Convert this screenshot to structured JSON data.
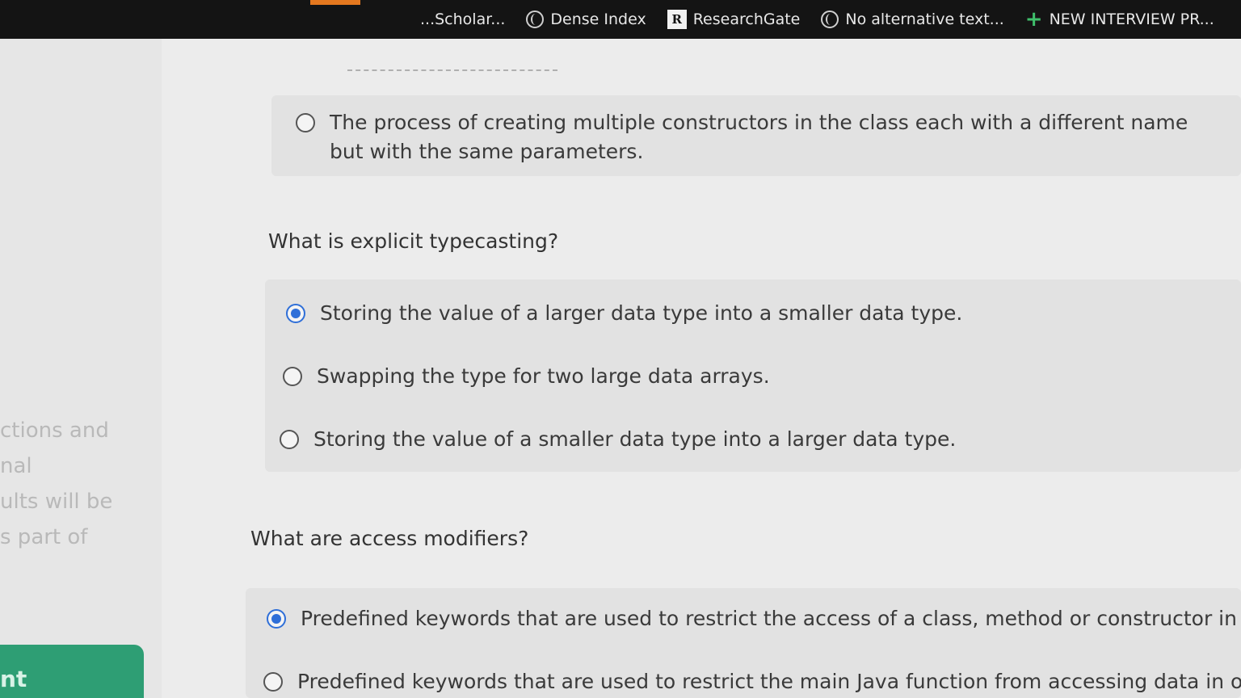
{
  "bookmarks": {
    "items": [
      {
        "label": "...Scholar...",
        "icon": "globe-icon"
      },
      {
        "label": "Dense Index",
        "icon": "globe-icon"
      },
      {
        "label": "ResearchGate",
        "icon": "researchgate-icon",
        "icon_text": "R"
      },
      {
        "label": "No alternative text...",
        "icon": "globe-icon"
      },
      {
        "label": "NEW INTERVIEW PR...",
        "icon": "plus-icon"
      }
    ]
  },
  "sidebar": {
    "fragments": [
      "ctions and",
      "nal",
      "ults will be",
      "s part of"
    ],
    "green_button_label": "nt"
  },
  "quiz": {
    "q1": {
      "options": [
        {
          "text": "The process of creating multiple constructors in the class each with a different name but with the same parameters.",
          "checked": false
        }
      ]
    },
    "q2": {
      "question": "What is explicit typecasting?",
      "options": [
        {
          "text": "Storing the value of a larger data type into a smaller data type.",
          "checked": true
        },
        {
          "text": "Swapping the type for two large data arrays.",
          "checked": false
        },
        {
          "text": "Storing the value of a smaller data type into a larger data type.",
          "checked": false
        }
      ]
    },
    "q3": {
      "question": "What are access modifiers?",
      "options": [
        {
          "text": "Predefined keywords that are used to restrict the access of a class, method or constructor in another",
          "checked": true
        },
        {
          "text": "Predefined keywords that are used to restrict the main Java function from accessing data in other",
          "checked": false
        }
      ]
    }
  },
  "colors": {
    "accent": "#2f6fd8",
    "green_button": "#2e9e74",
    "bookmark_bar": "#141414"
  }
}
